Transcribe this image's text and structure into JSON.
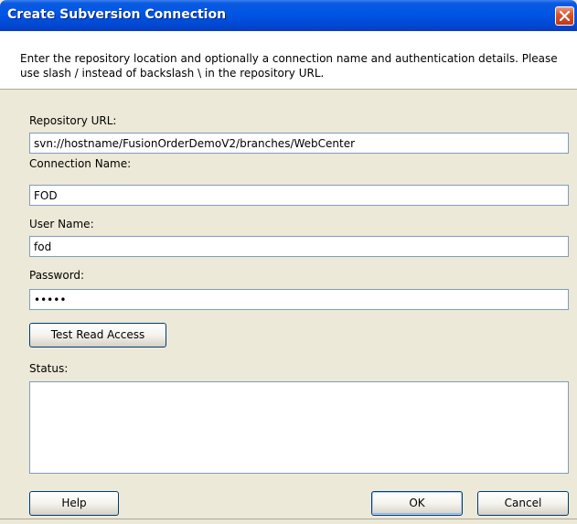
{
  "dialog": {
    "title": "Create Subversion Connection",
    "description": "Enter the repository location and optionally a connection name and authentication details. Please use slash / instead of backslash \\ in the repository URL."
  },
  "form": {
    "repository_url": {
      "label": "Repository URL:",
      "value": "svn://hostname/FusionOrderDemoV2/branches/WebCenter"
    },
    "connection_name": {
      "label": "Connection Name:",
      "value": "FOD"
    },
    "user_name": {
      "label": "User Name:",
      "value": "fod"
    },
    "password": {
      "label": "Password:",
      "value": "•••••"
    },
    "test_button": "Test Read Access",
    "status": {
      "label": "Status:",
      "value": ""
    }
  },
  "buttons": {
    "help": "Help",
    "ok": "OK",
    "cancel": "Cancel"
  },
  "colors": {
    "titlebar": "#0055e5",
    "dialog_bg": "#ece9d8",
    "close_button": "#d9542d",
    "field_border": "#7f9db9"
  }
}
